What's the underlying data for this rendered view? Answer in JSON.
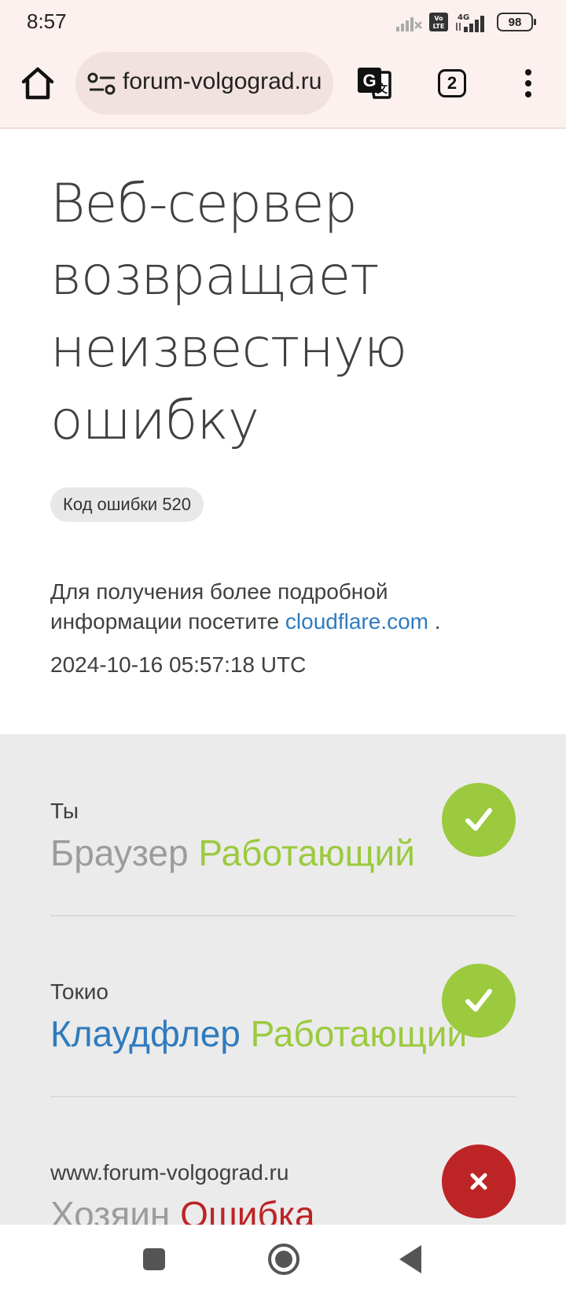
{
  "status_bar": {
    "time": "8:57",
    "network": "4G",
    "volte": "Vo LTE",
    "battery": "98"
  },
  "browser": {
    "url": "forum-volgograd.ru",
    "tab_count": "2",
    "icons": {
      "home": "home-icon",
      "site_settings": "site-settings-icon",
      "translate": "translate-icon",
      "tabs": "tabs-icon",
      "menu": "more-vert-icon"
    }
  },
  "page": {
    "title": "Веб-сервер возвращает неизвестную ошибку",
    "error_code": "Код ошибки 520",
    "desc_prefix": "Для получения более подробной информации посетите",
    "desc_link": "cloudflare.com",
    "desc_suffix": " .",
    "timestamp": "2024-10-16 05:57:18 UTC"
  },
  "statuses": [
    {
      "location": "Ты",
      "name": "Браузер",
      "state": "Работающий",
      "ok": true
    },
    {
      "location": "Токио",
      "name": "Клаудфлер",
      "state": "Работающий",
      "ok": true
    },
    {
      "location": "www.forum-volgograd.ru",
      "name": "Хозяин",
      "state": "Ошибка",
      "ok": false
    }
  ],
  "colors": {
    "ok": "#9bca3e",
    "error": "#bd2426",
    "link": "#2f7bbf",
    "chrome_bg": "#fdf1ef"
  }
}
